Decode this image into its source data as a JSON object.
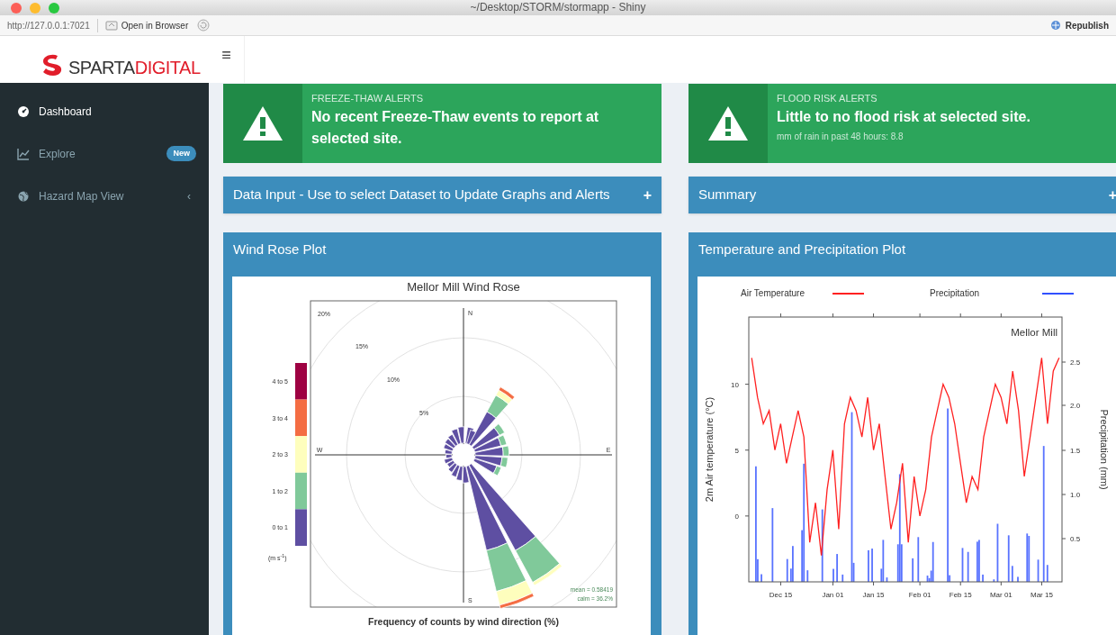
{
  "window": {
    "title": "~/Desktop/STORM/stormapp - Shiny"
  },
  "toolbar": {
    "url": "http://127.0.0.1:7021",
    "open_in_browser": "Open in Browser",
    "republish": "Republish"
  },
  "header": {
    "logo_part_1": "SPARTA",
    "logo_part_2": "DIGITAL",
    "menu_glyph": "≡"
  },
  "sidebar": {
    "items": [
      {
        "label": "Dashboard",
        "selected": true
      },
      {
        "label": "Explore",
        "selected": false,
        "badge": "New"
      },
      {
        "label": "Hazard Map View",
        "selected": false,
        "expand_glyph": "‹"
      }
    ]
  },
  "alerts": [
    {
      "heading": "FREEZE-THAW ALERTS",
      "message": "No recent Freeze-Thaw events to report at selected site."
    },
    {
      "heading": "FLOOD RISK ALERTS",
      "message": "Little to no flood risk at selected site.",
      "detail": "mm of rain in past 48 hours: 8.8"
    }
  ],
  "collapsible_boxes": [
    {
      "title": "Data Input - Use to select Dataset to Update Graphs and Alerts",
      "toggle": "+"
    },
    {
      "title": "Summary",
      "toggle": "+"
    }
  ],
  "plot_boxes": [
    {
      "title": "Wind Rose Plot",
      "kind": "windrose",
      "plot": {
        "title": "Mellor Mill Wind Rose",
        "ring_labels": [
          "20%",
          "15%",
          "10%",
          "5%"
        ],
        "compass": [
          "N",
          "E",
          "S",
          "W"
        ],
        "legend": [
          {
            "label": "4 to 5",
            "color": "#9e0142"
          },
          {
            "label": "3 to 4",
            "color": "#f46d43"
          },
          {
            "label": "2 to 3",
            "color": "#fefebd"
          },
          {
            "label": "1 to 2",
            "color": "#80c99a"
          },
          {
            "label": "0 to 1",
            "color": "#5e4fa2"
          }
        ],
        "unit": "(m s$^{-1}$)",
        "stats": [
          "mean = 0.58419",
          "calm = 36.2%"
        ],
        "xlabel": "Frequency of counts by wind direction (%)"
      }
    },
    {
      "title": "Temperature and Precipitation Plot",
      "kind": "timeseries",
      "plot": {
        "chart_data": {
          "type": "line",
          "ylabel": "2m Air temperature (°C)",
          "categories": [
            null,
            null,
            null,
            null,
            null,
            "Dec 15",
            null,
            null,
            null,
            null,
            null,
            null,
            null,
            null,
            "Jan 01",
            null,
            null,
            null,
            null,
            null,
            null,
            "Jan 15",
            null,
            null,
            null,
            null,
            null,
            null,
            null,
            "Feb 01",
            null,
            null,
            null,
            null,
            null,
            null,
            "Feb 15",
            null,
            null,
            null,
            null,
            null,
            null,
            "Mar 01",
            null,
            null,
            null,
            null,
            null,
            null,
            "Mar 15",
            null,
            null,
            null
          ],
          "series": [
            {
              "name": "Air Temperature",
              "color": "#ff2020",
              "values": [
                12,
                9,
                7,
                8,
                5,
                7,
                4,
                6,
                8,
                6,
                -2,
                1,
                -3,
                2,
                5,
                -1,
                7,
                9,
                8,
                6,
                9,
                5,
                7,
                3,
                -1,
                1,
                4,
                -2,
                3,
                0,
                2,
                6,
                8,
                10,
                9,
                7,
                4,
                1,
                3,
                2,
                6,
                8,
                10,
                9,
                7,
                11,
                8,
                3,
                6,
                9,
                12,
                7,
                11,
                12
              ]
            }
          ],
          "ylim": [
            -5,
            15.1
          ],
          "yticks": [
            10,
            5,
            0
          ]
        },
        "precipitation": {
          "name": "Precipitation",
          "color": "#3050ff"
        },
        "site_label": "Mellor Mill",
        "y_right_label": "Precipitation (mm)",
        "y_right_ticks": [
          "2.5",
          "2.0",
          "1.5",
          "1.0",
          "0.5"
        ]
      }
    }
  ]
}
